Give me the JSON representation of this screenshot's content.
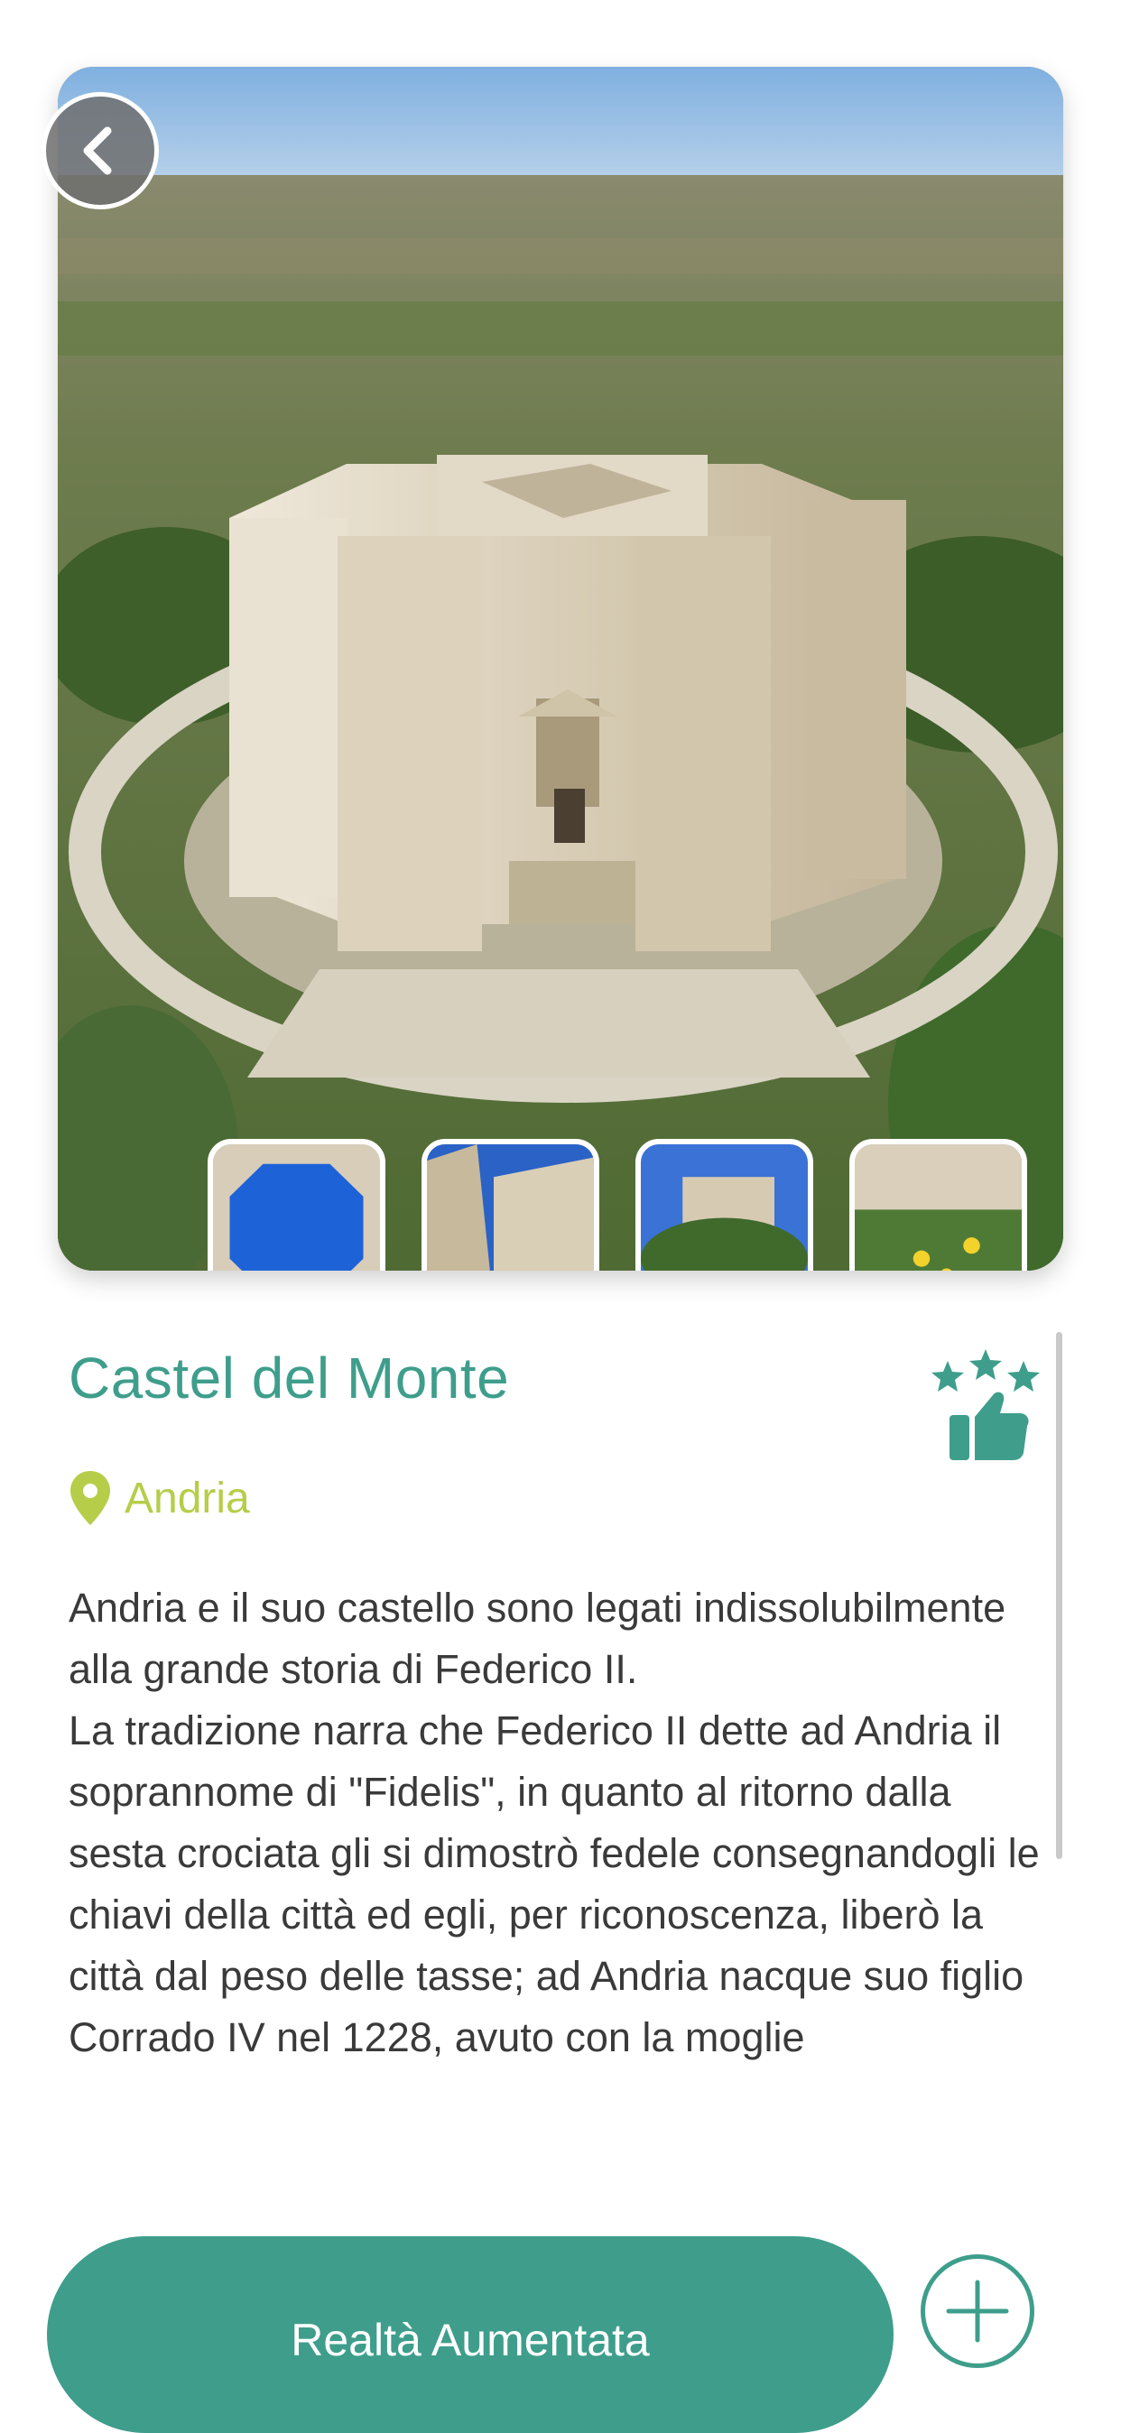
{
  "place": {
    "name": "Castel del Monte",
    "city": "Andria",
    "description": "Andria e il suo castello sono legati indissolubilmente alla grande storia di Federico II.\nLa tradizione narra che Federico II dette ad Andria il soprannome di \"Fidelis\", in quanto al ritorno dalla sesta crociata gli si dimostrò fedele consegnandogli le chiavi della città ed egli, per riconoscenza, liberò la città dal peso delle tasse; ad Andria nacque suo figlio Corrado IV nel 1228, avuto con la moglie"
  },
  "actions": {
    "ar_label": "Realtà Aumentata"
  },
  "icons": {
    "back": "chevron-left-icon",
    "location": "map-pin-icon",
    "rating": "stars-thumbs-up-icon",
    "add": "plus-circle-icon"
  },
  "colors": {
    "accent": "#3e9e8b",
    "location": "#b6cd4a",
    "text": "#3a3a3a"
  },
  "gallery": {
    "thumbnails": [
      "octagonal-courtyard-sky",
      "castle-wall-corner",
      "castle-with-trees",
      "castle-with-yellow-flowers"
    ]
  }
}
